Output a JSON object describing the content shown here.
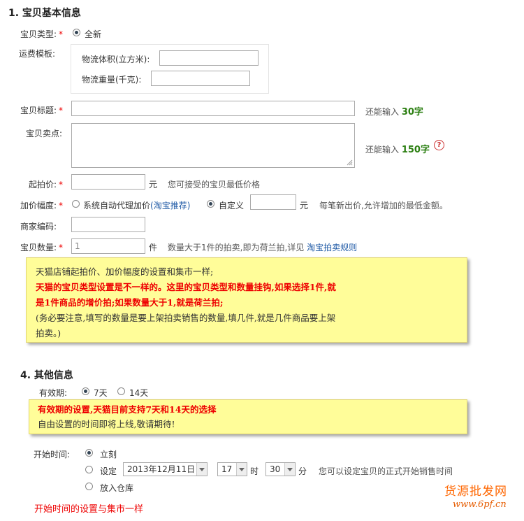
{
  "section1": {
    "title": "1. 宝贝基本信息",
    "type_label": "宝贝类型:",
    "type_option": "全新",
    "shipping_label": "运费模板:",
    "volume_label": "物流体积(立方米):",
    "weight_label": "物流重量(千克):",
    "title_label": "宝贝标题:",
    "title_hint_prefix": "还能输入",
    "title_hint_count": "30字",
    "selling_label": "宝贝卖点:",
    "selling_hint_prefix": "还能输入",
    "selling_hint_count": "150字",
    "help_glyph": "?",
    "start_price_label": "起拍价:",
    "start_price_unit": "元",
    "start_price_hint": "您可接受的宝贝最低价格",
    "increment_label": "加价幅度:",
    "increment_auto": "系统自动代理加价",
    "increment_auto_link": "(淘宝推荐)",
    "increment_custom": "自定义",
    "increment_unit": "元",
    "increment_hint": "每笔新出价,允许增加的最低金额。",
    "merchant_code_label": "商家编码:",
    "quantity_label": "宝贝数量:",
    "quantity_value": "1",
    "quantity_unit": "件",
    "quantity_hint": "数量大于1件的拍卖,即为荷兰拍,详见",
    "quantity_link": "淘宝拍卖规则"
  },
  "note1": {
    "line1": "天猫店铺起拍价、加价幅度的设置和集市一样;",
    "line2": "天猫的宝贝类型设置是不一样的。这里的宝贝类型和数量挂钩,如果选择1件,就",
    "line3": "是1件商品的增价拍;如果数量大于1,就是荷兰拍;",
    "line4": "(务必要注意,填写的数量是要上架拍卖销售的数量,填几件,就是几件商品要上架",
    "line5": "拍卖。)"
  },
  "section4": {
    "title": "4. 其他信息",
    "validity_label": "有效期:",
    "validity_7": "7天",
    "validity_14": "14天"
  },
  "note2": {
    "line1": "有效期的设置,天猫目前支持7天和14天的选择",
    "line2": "自由设置的时间即将上线,敬请期待!"
  },
  "start_time": {
    "label": "开始时间:",
    "now": "立刻",
    "set": "设定",
    "date": "2013年12月11日",
    "hour": "17",
    "hour_unit": "时",
    "minute": "30",
    "minute_unit": "分",
    "hint": "您可以设定宝贝的正式开始销售时间",
    "warehouse": "放入仓库"
  },
  "footer_note": "开始时间的设置与集市一样",
  "watermark": {
    "line1": "货源批发网",
    "line2": "www.6pf.cn"
  }
}
